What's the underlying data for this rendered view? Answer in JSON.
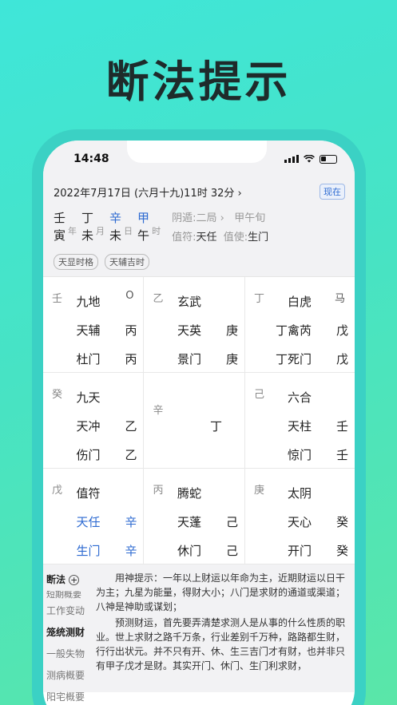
{
  "hero_title": "断法提示",
  "status": {
    "time": "14:48"
  },
  "header": {
    "date": "2022年7月17日 (六月十九)11时 32分",
    "chevron": "›",
    "now_label": "现在",
    "pillars": [
      {
        "top": "壬",
        "bottom": "寅",
        "label": "年",
        "highlight": false
      },
      {
        "top": "丁",
        "bottom": "未",
        "label": "月",
        "highlight": false
      },
      {
        "top": "辛",
        "bottom": "未",
        "label": "日",
        "highlight": true
      },
      {
        "top": "甲",
        "bottom": "午",
        "label": "时",
        "highlight": true
      }
    ],
    "ju": "阴遁:二局",
    "ju_chevron": "›",
    "xun": "甲午旬",
    "zhifu_label": "值符:",
    "zhifu_value": "天任",
    "zhishi_label": "值使:",
    "zhishi_value": "生门",
    "tags": [
      "天显时格",
      "天辅吉时"
    ]
  },
  "grid": [
    {
      "gan": "壬",
      "corner": "O",
      "rows": [
        [
          "九地",
          ""
        ],
        [
          "天辅",
          "丙"
        ],
        [
          "杜门",
          "丙"
        ]
      ]
    },
    {
      "gan": "乙",
      "corner": "",
      "rows": [
        [
          "玄武",
          ""
        ],
        [
          "天英",
          "庚"
        ],
        [
          "景门",
          "庚"
        ]
      ]
    },
    {
      "gan": "丁",
      "corner": "马",
      "rows": [
        [
          "白虎",
          ""
        ],
        [
          "禽芮",
          "戊"
        ],
        [
          "死门",
          "戊"
        ]
      ],
      "pre": [
        "",
        "丁",
        "丁"
      ]
    },
    {
      "gan": "癸",
      "corner": "",
      "rows": [
        [
          "九天",
          ""
        ],
        [
          "天冲",
          "乙"
        ],
        [
          "伤门",
          "乙"
        ]
      ]
    },
    {
      "gan": "辛",
      "corner": "",
      "center": "丁"
    },
    {
      "gan": "己",
      "corner": "",
      "rows": [
        [
          "六合",
          ""
        ],
        [
          "天柱",
          "壬"
        ],
        [
          "惊门",
          "壬"
        ]
      ]
    },
    {
      "gan": "戊",
      "corner": "",
      "rows": [
        [
          "值符",
          ""
        ],
        [
          "天任",
          "辛"
        ],
        [
          "生门",
          "辛"
        ]
      ],
      "blue_rows": [
        1,
        2
      ]
    },
    {
      "gan": "丙",
      "corner": "",
      "rows": [
        [
          "腾蛇",
          ""
        ],
        [
          "天蓬",
          "己"
        ],
        [
          "休门",
          "己"
        ]
      ]
    },
    {
      "gan": "庚",
      "corner": "",
      "rows": [
        [
          "太阴",
          ""
        ],
        [
          "天心",
          "癸"
        ],
        [
          "开门",
          "癸"
        ]
      ]
    }
  ],
  "side_menu": {
    "title": "断法",
    "items": [
      "短期概要",
      "工作变动",
      "笼统测财",
      "一般失物",
      "测病概要",
      "阳宅概要"
    ],
    "active": "笼统测财"
  },
  "content": {
    "paragraphs": [
      "用神提示：一年以上财运以年命为主，近期财运以日干为主；九星为能量，得财大小；八门是求财的通道或渠道；八神是神助或谋划；",
      "预测财运，首先要弄清楚求测人是从事的什么性质的职业。世上求财之路千万条，行业差别千万种，路路都生财，行行出状元。并不只有开、休、生三吉门才有财，也并非只有甲子戊才是财。其实开门、休门、生门利求财，"
    ]
  }
}
